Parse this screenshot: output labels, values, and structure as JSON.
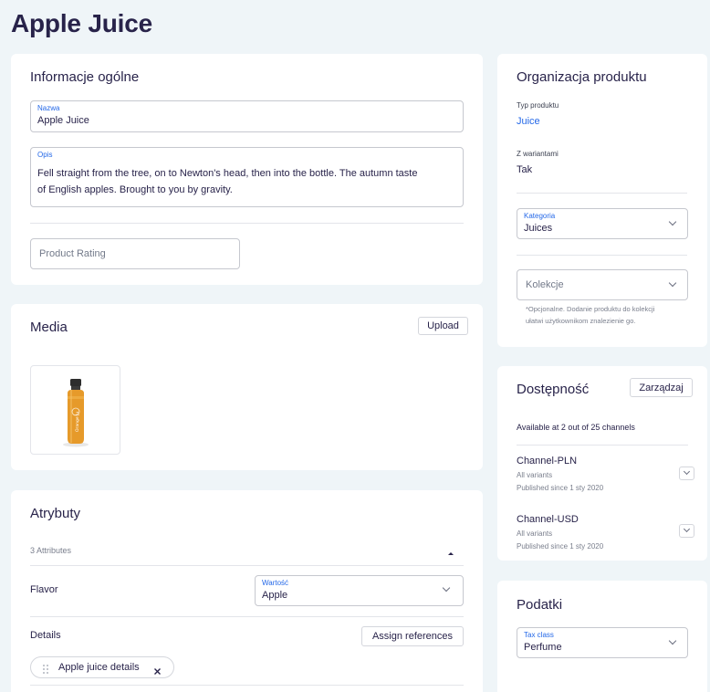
{
  "page": {
    "title": "Apple Juice"
  },
  "general": {
    "title": "Informacje ogólne",
    "name_label": "Nazwa",
    "name_value": "Apple Juice",
    "desc_label": "Opis",
    "desc_line1": "Fell straight from the tree, on to Newton's head, then into the bottle. The autumn taste",
    "desc_line2": "of English apples. Brought to you by gravity.",
    "rating_placeholder": "Product Rating"
  },
  "media": {
    "title": "Media",
    "upload_label": "Upload",
    "bottle_text": "Orange Ju"
  },
  "attributes": {
    "title": "Atrybuty",
    "count": "3 Attributes",
    "flavor_label": "Flavor",
    "flavor_field_label": "Wartość",
    "flavor_value": "Apple",
    "details_label": "Details",
    "assign_label": "Assign references",
    "chip_label": "Apple juice details"
  },
  "organization": {
    "title": "Organizacja produktu",
    "type_label": "Typ produktu",
    "type_value": "Juice",
    "variants_label": "Z wariantami",
    "variants_value": "Tak",
    "category_label": "Kategoria",
    "category_value": "Juices",
    "collections_placeholder": "Kolekcje",
    "collections_help_1": "*Opcjonalne. Dodanie produktu do kolekcji",
    "collections_help_2": "ułatwi użytkownikom znalezienie go."
  },
  "availability": {
    "title": "Dostępność",
    "manage_label": "Zarządzaj",
    "summary": "Available at 2 out of 25 channels",
    "channels": [
      {
        "name": "Channel-PLN",
        "variants": "All variants",
        "published": "Published since 1 sty 2020"
      },
      {
        "name": "Channel-USD",
        "variants": "All variants",
        "published": "Published since 1 sty 2020"
      }
    ]
  },
  "taxes": {
    "title": "Podatki",
    "tax_label": "Tax class",
    "tax_value": "Perfume"
  },
  "colors": {
    "primary_text": "#28234a",
    "accent": "#2468e8",
    "background": "#eff5f8",
    "bottle_orange": "#e69a2a"
  }
}
